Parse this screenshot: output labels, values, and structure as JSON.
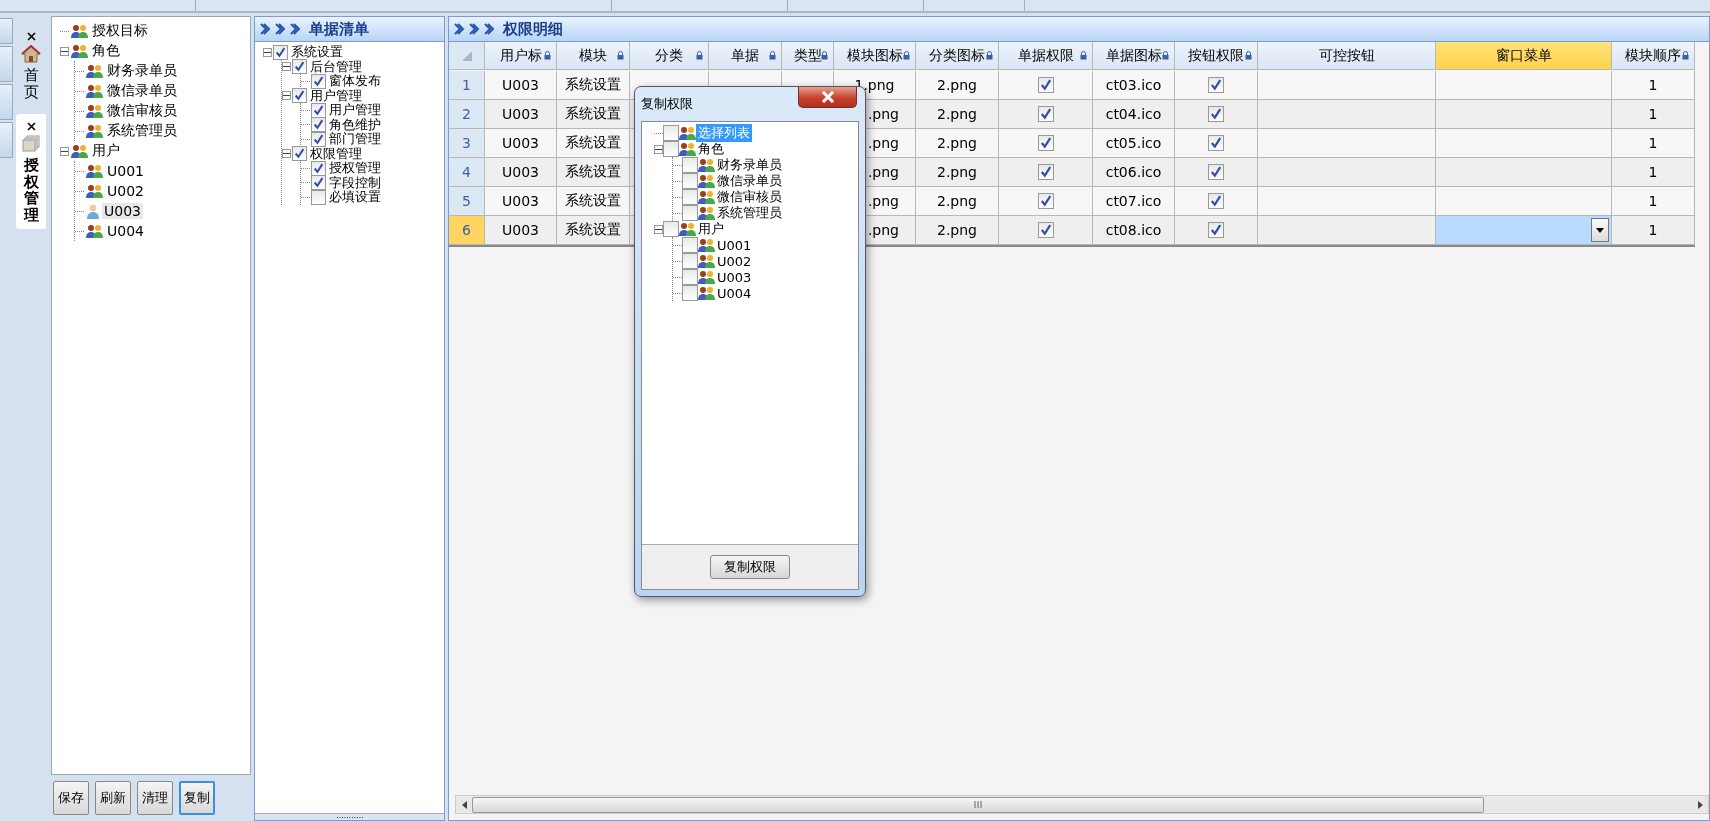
{
  "side_tabs": [
    {
      "label": "首页",
      "selected": false
    },
    {
      "label": "授权管理",
      "selected": true
    }
  ],
  "target_tree": [
    {
      "label": "授权目标",
      "kind": "group",
      "selected": false
    },
    {
      "label": "角色",
      "kind": "group",
      "selected": false,
      "expanded": true,
      "children": [
        {
          "label": "财务录单员",
          "kind": "group",
          "selected": false
        },
        {
          "label": "微信录单员",
          "kind": "group",
          "selected": false
        },
        {
          "label": "微信审核员",
          "kind": "group",
          "selected": false
        },
        {
          "label": "系统管理员",
          "kind": "group",
          "selected": false
        }
      ]
    },
    {
      "label": "用户",
      "kind": "group",
      "selected": false,
      "expanded": true,
      "children": [
        {
          "label": "U001",
          "kind": "group",
          "selected": false
        },
        {
          "label": "U002",
          "kind": "group",
          "selected": false
        },
        {
          "label": "U003",
          "kind": "user",
          "selected": true
        },
        {
          "label": "U004",
          "kind": "group",
          "selected": false
        }
      ]
    }
  ],
  "buttons": [
    {
      "label": "保存",
      "focused": false
    },
    {
      "label": "刷新",
      "focused": false
    },
    {
      "label": "清理",
      "focused": false
    },
    {
      "label": "复制",
      "focused": true
    }
  ],
  "doc_panel": {
    "title": "单据清单",
    "tree": [
      {
        "label": "系统设置",
        "checked": true,
        "expanded": true,
        "children": [
          {
            "label": "后台管理",
            "checked": true,
            "expanded": true,
            "children": [
              {
                "label": "窗体发布",
                "checked": true
              }
            ]
          },
          {
            "label": "用户管理",
            "checked": true,
            "expanded": true,
            "children": [
              {
                "label": "用户管理",
                "checked": true
              },
              {
                "label": "角色维护",
                "checked": true
              },
              {
                "label": "部门管理",
                "checked": true
              }
            ]
          },
          {
            "label": "权限管理",
            "checked": true,
            "expanded": true,
            "children": [
              {
                "label": "授权管理",
                "checked": true
              },
              {
                "label": "字段控制",
                "checked": true
              },
              {
                "label": "必填设置",
                "checked": false
              }
            ]
          }
        ]
      }
    ]
  },
  "detail_panel": {
    "title": "权限明细",
    "columns": [
      {
        "label": "用户标",
        "locked": true,
        "selected": false
      },
      {
        "label": "模块",
        "locked": true,
        "selected": false
      },
      {
        "label": "分类",
        "locked": true,
        "selected": false
      },
      {
        "label": "单据",
        "locked": true,
        "selected": false
      },
      {
        "label": "类型",
        "locked": true,
        "selected": false
      },
      {
        "label": "模块图标",
        "locked": true,
        "selected": false
      },
      {
        "label": "分类图标",
        "locked": true,
        "selected": false
      },
      {
        "label": "单据权限",
        "locked": true,
        "selected": false
      },
      {
        "label": "单据图标",
        "locked": true,
        "selected": false
      },
      {
        "label": "按钮权限",
        "locked": true,
        "selected": false
      },
      {
        "label": "可控按钮",
        "locked": false,
        "selected": false
      },
      {
        "label": "窗口菜单",
        "locked": false,
        "selected": true
      },
      {
        "label": "模块顺序",
        "locked": true,
        "selected": false
      }
    ],
    "rows": [
      {
        "number": "1",
        "selected": false,
        "cells": [
          {
            "kind": "text",
            "text": "U003"
          },
          {
            "kind": "text",
            "text": "系统设置"
          },
          {
            "kind": "blank"
          },
          {
            "kind": "blank"
          },
          {
            "kind": "blank"
          },
          {
            "kind": "text",
            "text": "1.png"
          },
          {
            "kind": "text",
            "text": "2.png"
          },
          {
            "kind": "check",
            "checked": true
          },
          {
            "kind": "text",
            "text": "ct03.ico"
          },
          {
            "kind": "check",
            "checked": true
          },
          {
            "kind": "blank"
          },
          {
            "kind": "blank"
          },
          {
            "kind": "text",
            "text": "1"
          }
        ]
      },
      {
        "number": "2",
        "selected": false,
        "cells": [
          {
            "kind": "text",
            "text": "U003"
          },
          {
            "kind": "text",
            "text": "系统设置"
          },
          {
            "kind": "covered"
          },
          {
            "kind": "covered"
          },
          {
            "kind": "covered"
          },
          {
            "kind": "tail",
            "text": ".png"
          },
          {
            "kind": "text",
            "text": "2.png"
          },
          {
            "kind": "check",
            "checked": true
          },
          {
            "kind": "text",
            "text": "ct04.ico"
          },
          {
            "kind": "check",
            "checked": true
          },
          {
            "kind": "blank"
          },
          {
            "kind": "blank"
          },
          {
            "kind": "text",
            "text": "1"
          }
        ]
      },
      {
        "number": "3",
        "selected": false,
        "cells": [
          {
            "kind": "text",
            "text": "U003"
          },
          {
            "kind": "text",
            "text": "系统设置"
          },
          {
            "kind": "covered"
          },
          {
            "kind": "covered"
          },
          {
            "kind": "covered"
          },
          {
            "kind": "tail",
            "text": ".png"
          },
          {
            "kind": "text",
            "text": "2.png"
          },
          {
            "kind": "check",
            "checked": true
          },
          {
            "kind": "text",
            "text": "ct05.ico"
          },
          {
            "kind": "check",
            "checked": true
          },
          {
            "kind": "blank"
          },
          {
            "kind": "blank"
          },
          {
            "kind": "text",
            "text": "1"
          }
        ]
      },
      {
        "number": "4",
        "selected": false,
        "cells": [
          {
            "kind": "text",
            "text": "U003"
          },
          {
            "kind": "text",
            "text": "系统设置"
          },
          {
            "kind": "covered"
          },
          {
            "kind": "covered"
          },
          {
            "kind": "covered"
          },
          {
            "kind": "tail",
            "text": ".png"
          },
          {
            "kind": "text",
            "text": "2.png"
          },
          {
            "kind": "check",
            "checked": true
          },
          {
            "kind": "text",
            "text": "ct06.ico"
          },
          {
            "kind": "check",
            "checked": true
          },
          {
            "kind": "blank"
          },
          {
            "kind": "blank"
          },
          {
            "kind": "text",
            "text": "1"
          }
        ]
      },
      {
        "number": "5",
        "selected": false,
        "cells": [
          {
            "kind": "text",
            "text": "U003"
          },
          {
            "kind": "text",
            "text": "系统设置"
          },
          {
            "kind": "covered"
          },
          {
            "kind": "covered"
          },
          {
            "kind": "covered"
          },
          {
            "kind": "tail",
            "text": ".png"
          },
          {
            "kind": "text",
            "text": "2.png"
          },
          {
            "kind": "check",
            "checked": true
          },
          {
            "kind": "text",
            "text": "ct07.ico"
          },
          {
            "kind": "check",
            "checked": true
          },
          {
            "kind": "blank"
          },
          {
            "kind": "blank"
          },
          {
            "kind": "text",
            "text": "1"
          }
        ]
      },
      {
        "number": "6",
        "selected": true,
        "cells": [
          {
            "kind": "text",
            "text": "U003"
          },
          {
            "kind": "text",
            "text": "系统设置"
          },
          {
            "kind": "covered"
          },
          {
            "kind": "covered"
          },
          {
            "kind": "covered"
          },
          {
            "kind": "tail",
            "text": ".png"
          },
          {
            "kind": "text",
            "text": "2.png"
          },
          {
            "kind": "check",
            "checked": true
          },
          {
            "kind": "text",
            "text": "ct08.ico"
          },
          {
            "kind": "check",
            "checked": true
          },
          {
            "kind": "blank"
          },
          {
            "kind": "dropdown"
          },
          {
            "kind": "text",
            "text": "1"
          }
        ]
      }
    ]
  },
  "dialog": {
    "title": "复制权限",
    "tree": [
      {
        "label": "选择列表",
        "kind": "group",
        "checked": false,
        "selected": true
      },
      {
        "label": "角色",
        "kind": "group",
        "checked": false,
        "selected": false,
        "expanded": true,
        "children": [
          {
            "label": "财务录单员",
            "kind": "group",
            "checked": false,
            "selected": false
          },
          {
            "label": "微信录单员",
            "kind": "group",
            "checked": false,
            "selected": false
          },
          {
            "label": "微信审核员",
            "kind": "group",
            "checked": false,
            "selected": false
          },
          {
            "label": "系统管理员",
            "kind": "group",
            "checked": false,
            "selected": false
          }
        ]
      },
      {
        "label": "用户",
        "kind": "group",
        "checked": false,
        "selected": false,
        "expanded": true,
        "children": [
          {
            "label": "U001",
            "kind": "group",
            "checked": false,
            "selected": false
          },
          {
            "label": "U002",
            "kind": "group",
            "checked": false,
            "selected": false
          },
          {
            "label": "U003",
            "kind": "group",
            "checked": false,
            "selected": false
          },
          {
            "label": "U004",
            "kind": "group",
            "checked": false,
            "selected": false
          }
        ]
      }
    ],
    "button": "复制权限"
  }
}
